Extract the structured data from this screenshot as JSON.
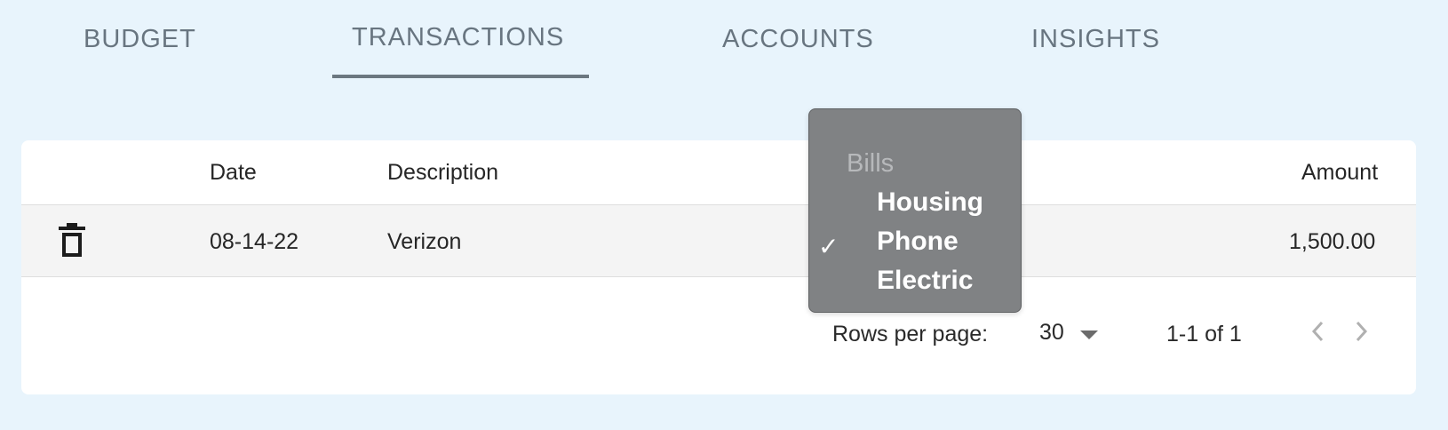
{
  "tabs": [
    {
      "label": "BUDGET"
    },
    {
      "label": "TRANSACTIONS",
      "active": true
    },
    {
      "label": "ACCOUNTS"
    },
    {
      "label": "INSIGHTS"
    }
  ],
  "table": {
    "headers": {
      "date": "Date",
      "description": "Description",
      "amount": "Amount"
    },
    "rows": [
      {
        "date": "08-14-22",
        "description": "Verizon",
        "amount": "1,500.00"
      }
    ]
  },
  "pagination": {
    "rows_per_page_label": "Rows per page:",
    "rows_per_page_value": "30",
    "range_text": "1-1 of 1"
  },
  "category_menu": {
    "group_label": "Bills",
    "options": [
      {
        "label": "Housing"
      },
      {
        "label": "Phone",
        "selected": true
      },
      {
        "label": "Electric"
      }
    ],
    "check_mark": "✓"
  },
  "colors": {
    "background": "#e8f4fc",
    "tab_text": "#687580",
    "menu_bg": "#808284"
  },
  "icons": {
    "row_action": "trash-icon",
    "prev_page": "chevron-left-icon",
    "next_page": "chevron-right-icon",
    "rows_dropdown": "caret-down-icon"
  }
}
